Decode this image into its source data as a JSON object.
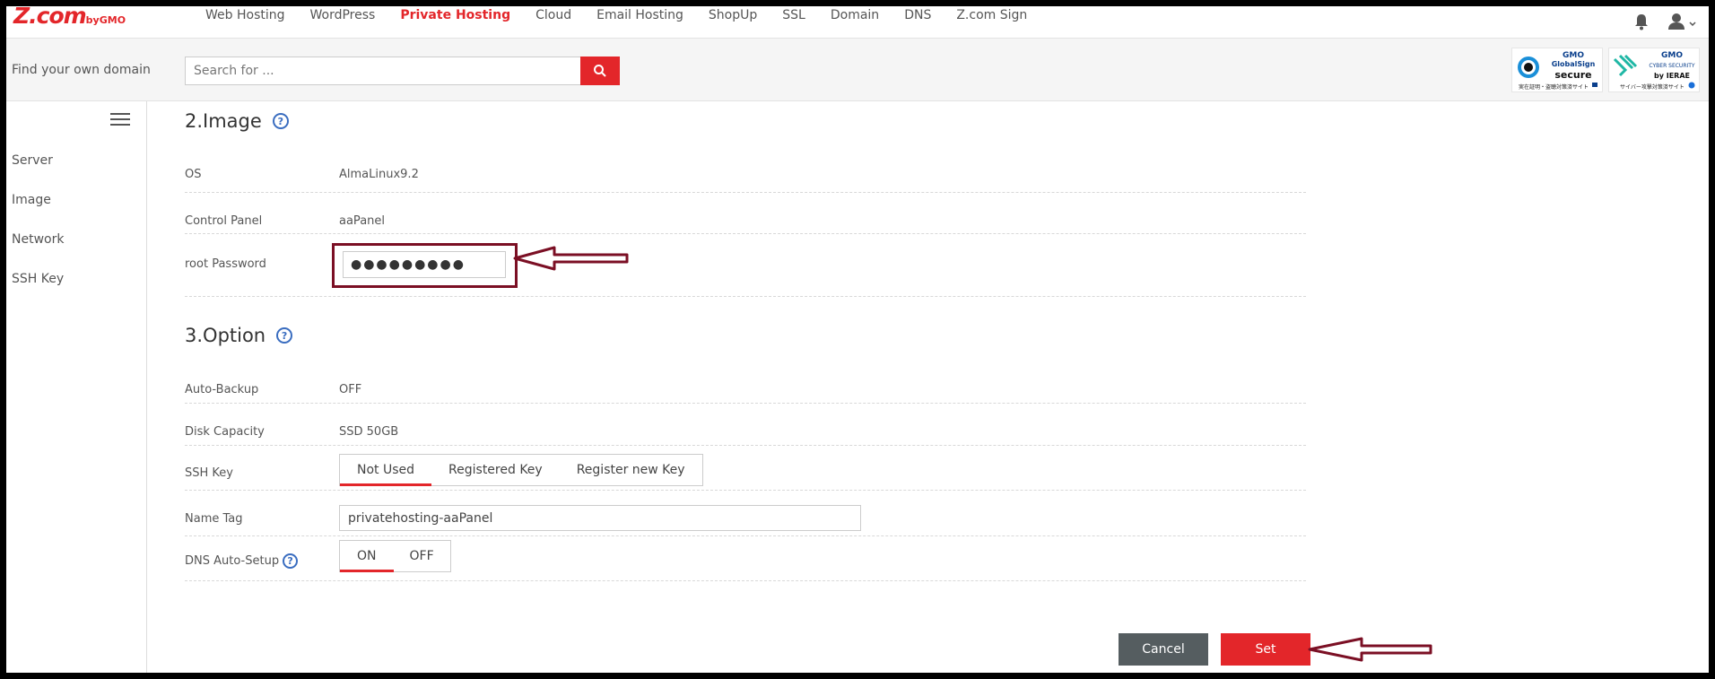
{
  "brand": {
    "logo_main": "Z.com",
    "logo_by": "by",
    "logo_gmo": "GMO",
    "accent": "#e3262a"
  },
  "nav": {
    "links": [
      "Web Hosting",
      "WordPress",
      "Private Hosting",
      "Cloud",
      "Email Hosting",
      "ShopUp",
      "SSL",
      "Domain",
      "DNS",
      "Z.com Sign"
    ],
    "active": "Private Hosting",
    "icons": [
      "bell-icon",
      "user-icon",
      "chevron-down-icon"
    ]
  },
  "search": {
    "label": "Find your own domain",
    "placeholder": "Search for ..."
  },
  "badges": {
    "globalsign": {
      "brand": "GMO",
      "name": "GlobalSign",
      "word": "secure",
      "caption": "実在証明・盗聴対策済サイト"
    },
    "ierae": {
      "brand": "GMO",
      "name": "CYBER SECURITY",
      "by": "by IERAE",
      "caption": "サイバー攻撃対策済サイト"
    }
  },
  "sidebar": {
    "items": [
      "Server",
      "Image",
      "Network",
      "SSH Key"
    ]
  },
  "image_section": {
    "title": "2.Image",
    "help": "?",
    "os_label": "OS",
    "os_value": "AlmaLinux9.2",
    "panel_label": "Control Panel",
    "panel_value": "aaPanel",
    "pwd_label": "root Password",
    "pwd_value": "●●●●●●●●●"
  },
  "option_section": {
    "title": "3.Option",
    "help": "?",
    "backup_label": "Auto-Backup",
    "backup_value": "OFF",
    "disk_label": "Disk Capacity",
    "disk_value": "SSD 50GB",
    "ssh_label": "SSH Key",
    "ssh_options": [
      "Not Used",
      "Registered Key",
      "Register new Key"
    ],
    "ssh_selected": "Not Used",
    "tag_label": "Name Tag",
    "tag_value": "privatehosting-aaPanel",
    "dns_label": "DNS Auto-Setup",
    "dns_options": [
      "ON",
      "OFF"
    ],
    "dns_selected": "ON"
  },
  "actions": {
    "cancel": "Cancel",
    "set": "Set"
  },
  "annotation_color": "#7b0f24"
}
